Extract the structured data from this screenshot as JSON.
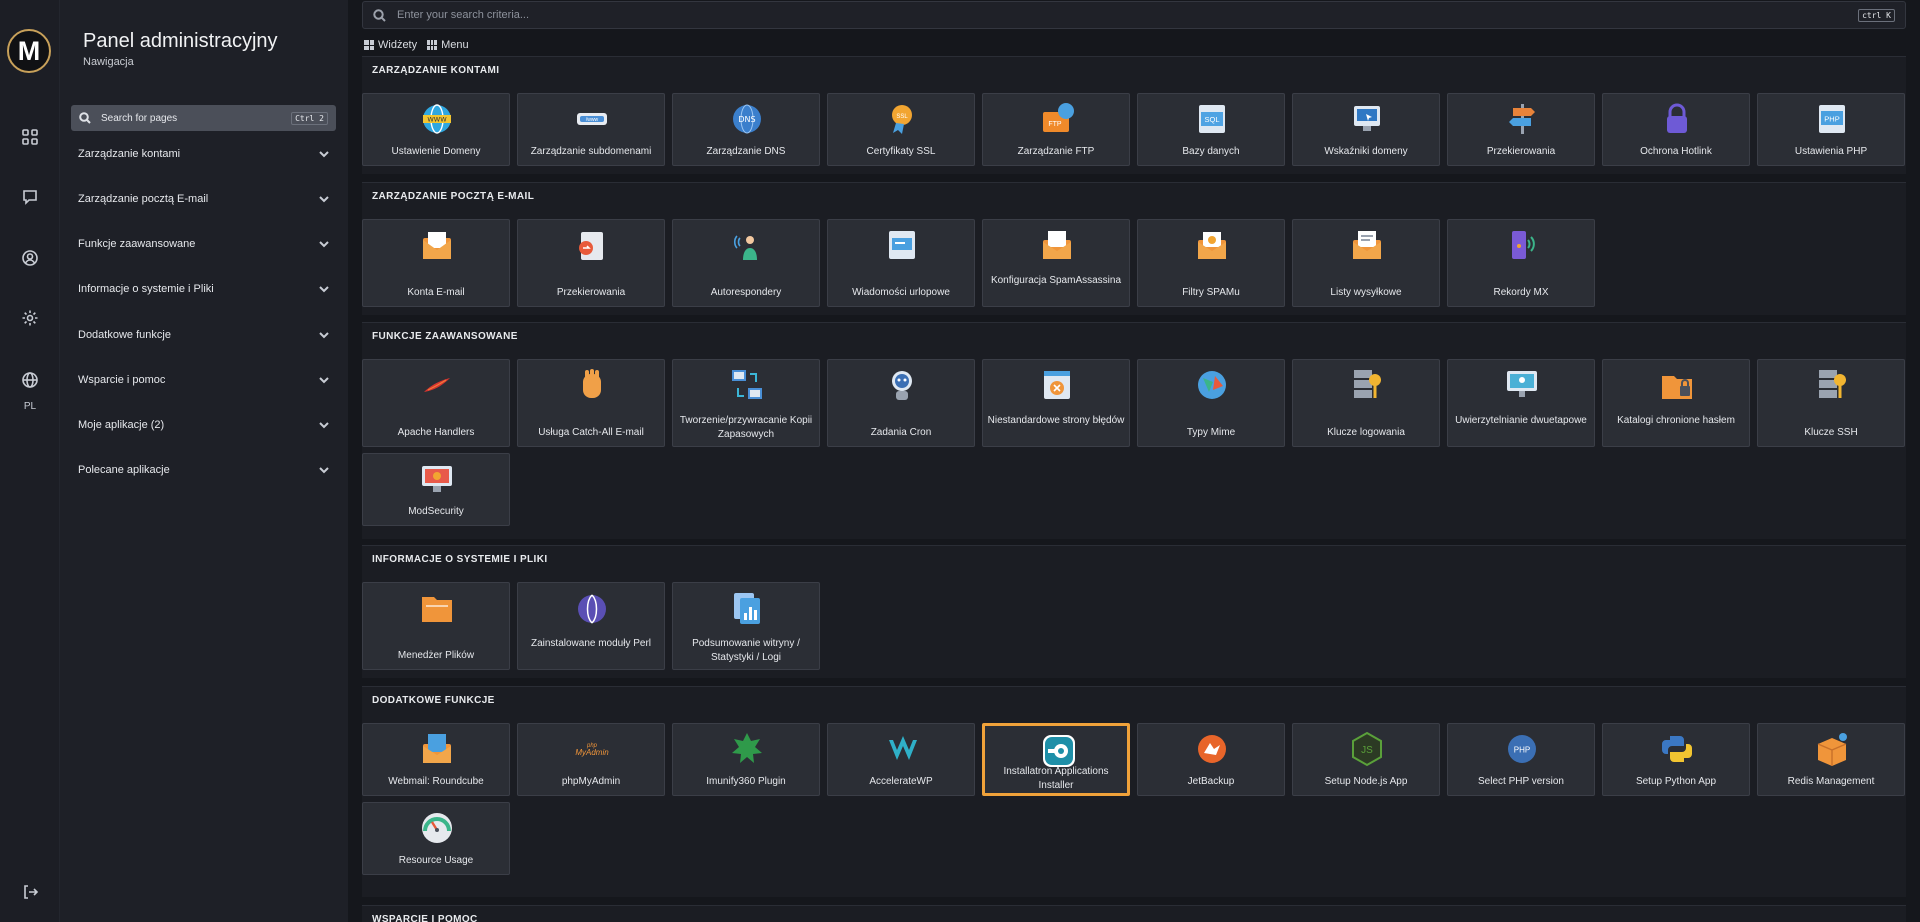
{
  "rail": {
    "logo": "M",
    "lang": "PL"
  },
  "nav": {
    "title": "Panel administracyjny",
    "subtitle": "Nawigacja",
    "search_placeholder": "Search for pages",
    "search_shortcut": "Ctrl 2",
    "items": [
      "Zarządzanie kontami",
      "Zarządzanie pocztą E-mail",
      "Funkcje zaawansowane",
      "Informacje o systemie i Pliki",
      "Dodatkowe funkcje",
      "Wsparcie i pomoc",
      "Moje aplikacje (2)",
      "Polecane aplikacje"
    ]
  },
  "main": {
    "search_placeholder": "Enter your search criteria...",
    "search_shortcut": "ctrl K",
    "toolbar": {
      "widgets": "Widżety",
      "menu": "Menu"
    },
    "sections": [
      {
        "title": "ZARZĄDZANIE KONTAMI",
        "tiles": [
          {
            "label": "Ustawienie Domeny",
            "icon": "www-globe-icon",
            "color": "#2fa7e0"
          },
          {
            "label": "Zarządzanie subdomenami",
            "icon": "subdomain-icon",
            "color": "#4a8fd6"
          },
          {
            "label": "Zarządzanie DNS",
            "icon": "dns-globe-icon",
            "color": "#3b7fcc"
          },
          {
            "label": "Certyfikaty SSL",
            "icon": "ssl-badge-icon",
            "color": "#f2a531"
          },
          {
            "label": "Zarządzanie FTP",
            "icon": "ftp-folder-icon",
            "color": "#f08a2a"
          },
          {
            "label": "Bazy danych",
            "icon": "sql-database-icon",
            "color": "#4fa3e3"
          },
          {
            "label": "Wskaźniki domeny",
            "icon": "domain-pointer-icon",
            "color": "#2f78c4"
          },
          {
            "label": "Przekierowania",
            "icon": "signpost-icon",
            "color": "#e8833a"
          },
          {
            "label": "Ochrona Hotlink",
            "icon": "padlock-icon",
            "color": "#6e5ad6"
          },
          {
            "label": "Ustawienia PHP",
            "icon": "php-icon",
            "color": "#4aa0e0"
          }
        ]
      },
      {
        "title": "ZARZĄDZANIE POCZTĄ E-MAIL",
        "tiles": [
          {
            "label": "Konta E-mail",
            "icon": "mail-envelope-icon",
            "color": "#f0953a"
          },
          {
            "label": "Przekierowania",
            "icon": "mail-forward-icon",
            "color": "#e85a3a"
          },
          {
            "label": "Autorespondery",
            "icon": "autoresponder-icon",
            "color": "#3bb58a"
          },
          {
            "label": "Wiadomości urlopowe",
            "icon": "vacation-message-icon",
            "color": "#4aa0e0"
          },
          {
            "label": "Konfiguracja SpamAssassina",
            "icon": "spam-config-icon",
            "color": "#f0953a"
          },
          {
            "label": "Filtry SPAMu",
            "icon": "spam-filter-icon",
            "color": "#f0953a"
          },
          {
            "label": "Listy wysyłkowe",
            "icon": "mailing-list-icon",
            "color": "#f0953a"
          },
          {
            "label": "Rekordy MX",
            "icon": "mx-records-icon",
            "color": "#7a5ad6"
          }
        ]
      },
      {
        "title": "FUNKCJE ZAAWANSOWANE",
        "tiles": [
          {
            "label": "Apache Handlers",
            "icon": "apache-feather-icon",
            "color": "#d8342f"
          },
          {
            "label": "Usługa Catch-All E-mail",
            "icon": "catch-hand-icon",
            "color": "#f0a048"
          },
          {
            "label": "Tworzenie/przywracanie Kopii Zapasowych",
            "icon": "backup-restore-icon",
            "color": "#4a8fd6"
          },
          {
            "label": "Zadania Cron",
            "icon": "cron-robot-icon",
            "color": "#3b6fb4"
          },
          {
            "label": "Niestandardowe strony błędów",
            "icon": "error-page-icon",
            "color": "#f0953a"
          },
          {
            "label": "Typy Mime",
            "icon": "mime-types-icon",
            "color": "#4aa0e0"
          },
          {
            "label": "Klucze logowania",
            "icon": "server-key-icon",
            "color": "#f2b531"
          },
          {
            "label": "Uwierzytelnianie dwuetapowe",
            "icon": "two-factor-icon",
            "color": "#4ab0d6"
          },
          {
            "label": "Katalogi chronione hasłem",
            "icon": "protected-folder-icon",
            "color": "#f0953a"
          },
          {
            "label": "Klucze SSH",
            "icon": "ssh-key-icon",
            "color": "#f2b531"
          },
          {
            "label": "ModSecurity",
            "icon": "modsecurity-icon",
            "color": "#e85a4a"
          }
        ]
      },
      {
        "title": "INFORMACJE O SYSTEMIE I PLIKI",
        "tiles": [
          {
            "label": "Menedżer Plików",
            "icon": "file-manager-icon",
            "color": "#f0953a"
          },
          {
            "label": "Zainstalowane moduły Perl",
            "icon": "perl-onion-icon",
            "color": "#5a4fb4"
          },
          {
            "label": "Podsumowanie witryny / Statystyki / Logi",
            "icon": "site-stats-icon",
            "color": "#4aa0e0"
          }
        ]
      },
      {
        "title": "DODATKOWE FUNKCJE",
        "tiles": [
          {
            "label": "Webmail: Roundcube",
            "icon": "roundcube-icon",
            "color": "#4aa0e0"
          },
          {
            "label": "phpMyAdmin",
            "icon": "phpmyadmin-icon",
            "color": "#f0953a",
            "sublabel": "MyAdmin"
          },
          {
            "label": "Imunify360 Plugin",
            "icon": "imunify-icon",
            "color": "#2f9a4a"
          },
          {
            "label": "AccelerateWP",
            "icon": "acceleratewp-icon",
            "color": "#2fb0c8"
          },
          {
            "label": "Installatron Applications Installer",
            "icon": "installatron-icon",
            "color": "#1e8fa8",
            "highlighted": true
          },
          {
            "label": "JetBackup",
            "icon": "jetbackup-icon",
            "color": "#e8652a"
          },
          {
            "label": "Setup Node.js App",
            "icon": "nodejs-icon",
            "color": "#5aa03a"
          },
          {
            "label": "Select PHP version",
            "icon": "php-version-icon",
            "color": "#3b6fb4"
          },
          {
            "label": "Setup Python App",
            "icon": "python-icon",
            "color": "#3b78c4"
          },
          {
            "label": "Redis Management",
            "icon": "redis-box-icon",
            "color": "#f0953a"
          },
          {
            "label": "Resource Usage",
            "icon": "gauge-icon",
            "color": "#e85a3a"
          }
        ]
      },
      {
        "title": "WSPARCIE I POMOC",
        "tiles": []
      }
    ]
  }
}
